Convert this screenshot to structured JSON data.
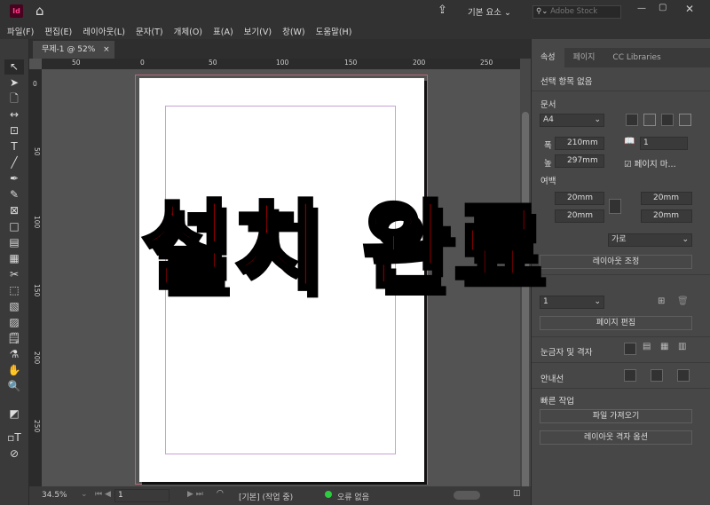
{
  "app": {
    "logo": "Id",
    "workspace": "기본 요소",
    "search_placeholder": "Adobe Stock"
  },
  "menu": [
    "파일(F)",
    "편집(E)",
    "레이아웃(L)",
    "문자(T)",
    "개체(O)",
    "표(A)",
    "보기(V)",
    "창(W)",
    "도움말(H)"
  ],
  "document_tab": {
    "title": "무제-1 @ 52%",
    "close": "×"
  },
  "hruler": [
    "50",
    "0",
    "50",
    "100",
    "150",
    "200",
    "250"
  ],
  "vruler": [
    "0",
    "50",
    "100",
    "150",
    "200",
    "250"
  ],
  "panel": {
    "tabs": [
      "속성",
      "페이지",
      "CC Libraries"
    ],
    "selection": "선택 항목 없음",
    "document_label": "문서",
    "page_size": "A4",
    "width_label": "폭",
    "width": "210mm",
    "height_label": "높",
    "height": "297mm",
    "pages": "1",
    "facing_pages": "페이지 마...",
    "margins_label": "여백",
    "margin_top": "20mm",
    "margin_bottom": "20mm",
    "margin_left": "20mm",
    "margin_right": "20mm",
    "orientation": "가로",
    "adjust_layout": "레이아웃 조정",
    "page_select": "1",
    "edit_page": "페이지 편집",
    "rulers_grids": "눈금자 및 격자",
    "guides": "안내선",
    "quick_actions": "빠른 작업",
    "import_file": "파일 가져오기",
    "layout_grid_options": "레이아웃 격자 옵션"
  },
  "status": {
    "zoom": "34.5%",
    "page": "1",
    "preflight_profile": "[기본] (작업 중)",
    "errors": "오류 없음",
    "ok_color": "#2ecc40"
  },
  "overlay_text": "설치 완료"
}
